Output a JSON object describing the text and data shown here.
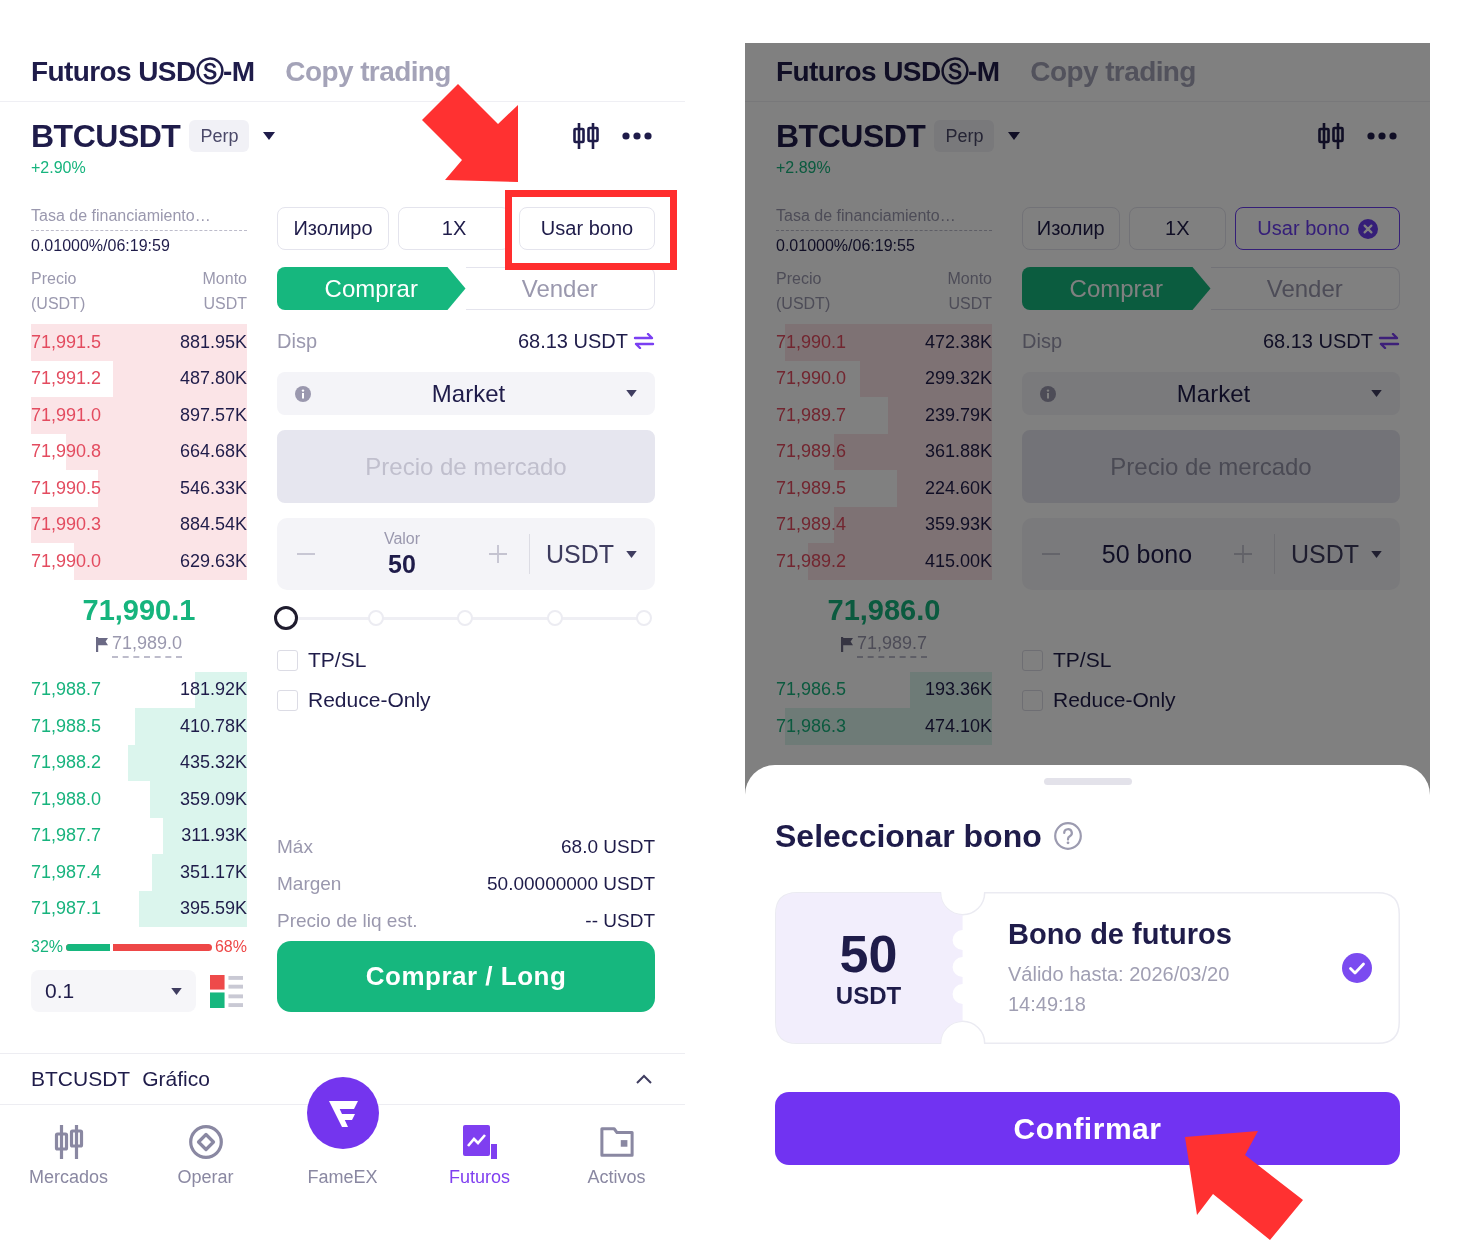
{
  "screens": [
    {
      "dimmed": false,
      "tabs": [
        {
          "label": "Futuros USDⓈ-M",
          "selected": true
        },
        {
          "label": "Copy trading",
          "selected": false
        }
      ],
      "symbol": {
        "name": "BTCUSDT",
        "badge": "Perp",
        "change": "+2.90%"
      },
      "funding": {
        "label": "Tasa de financiamiento…",
        "value": "0.01000%/06:19:59"
      },
      "book_columns": [
        "Precio (USDT)",
        "Monto USDT"
      ],
      "asks": [
        {
          "price": "71,991.5",
          "amount": "881.95K",
          "level": 1
        },
        {
          "price": "71,991.2",
          "amount": "487.80K",
          "level": 0.62
        },
        {
          "price": "71,991.0",
          "amount": "897.57K",
          "level": 1
        },
        {
          "price": "71,990.8",
          "amount": "664.68K",
          "level": 0.84
        },
        {
          "price": "71,990.5",
          "amount": "546.33K",
          "level": 0.69
        },
        {
          "price": "71,990.3",
          "amount": "884.54K",
          "level": 1
        },
        {
          "price": "71,990.0",
          "amount": "629.63K",
          "level": 0.8
        }
      ],
      "last_price": "71,990.1",
      "mark_price": "71,989.0",
      "bids": [
        {
          "price": "71,988.7",
          "amount": "181.92K",
          "level": 0.24
        },
        {
          "price": "71,988.5",
          "amount": "410.78K",
          "level": 0.52
        },
        {
          "price": "71,988.2",
          "amount": "435.32K",
          "level": 0.55
        },
        {
          "price": "71,988.0",
          "amount": "359.09K",
          "level": 0.45
        },
        {
          "price": "71,987.7",
          "amount": "311.93K",
          "level": 0.39
        },
        {
          "price": "71,987.4",
          "amount": "351.17K",
          "level": 0.44
        },
        {
          "price": "71,987.1",
          "amount": "395.59K",
          "level": 0.5
        }
      ],
      "ratio": {
        "buy": "32%",
        "sell": "68%",
        "level": 0.32
      },
      "precision": "0.1",
      "controls": [
        "Изолиро",
        "1X"
      ],
      "bonus_button": {
        "label": "Usar bono",
        "applied": false,
        "highlighted": true
      },
      "sides": [
        {
          "label": "Comprar",
          "selected": true
        },
        {
          "label": "Vender",
          "selected": false
        }
      ],
      "available": {
        "label": "Disp",
        "value": "68.13 USDT"
      },
      "order_type": "Market",
      "price_field": {
        "placeholder": "Precio de mercado",
        "disabled": true
      },
      "amount_field": {
        "label": "Valor",
        "value": "50",
        "unit": "USDT"
      },
      "slider": {
        "level": 0
      },
      "options": [
        {
          "label": "TP/SL",
          "checked": false
        },
        {
          "label": "Reduce-Only",
          "checked": false
        }
      ],
      "summary": [
        {
          "label": "Máx",
          "value": "68.0 USDT"
        },
        {
          "label": "Margen",
          "value": "50.00000000 USDT"
        },
        {
          "label": "Precio de liq est.",
          "value": "-- USDT"
        }
      ],
      "submit": "Comprar / Long",
      "chart_bar": {
        "symbol": "BTCUSDT",
        "label": "Gráfico"
      },
      "nav": [
        {
          "label": "Mercados",
          "selected": false
        },
        {
          "label": "Operar",
          "selected": false
        },
        {
          "label": "FameEX",
          "selected": false
        },
        {
          "label": "Futuros",
          "selected": true
        },
        {
          "label": "Activos",
          "selected": false
        }
      ]
    },
    {
      "dimmed": true,
      "tabs": [
        {
          "label": "Futuros USDⓈ-M",
          "selected": true
        },
        {
          "label": "Copy trading",
          "selected": false
        }
      ],
      "symbol": {
        "name": "BTCUSDT",
        "badge": "Perp",
        "change": "+2.89%"
      },
      "funding": {
        "label": "Tasa de financiamiento…",
        "value": "0.01000%/06:19:55"
      },
      "book_columns": [
        "Precio (USDT)",
        "Monto USDT"
      ],
      "asks": [
        {
          "price": "71,990.1",
          "amount": "472.38K",
          "level": 0.96
        },
        {
          "price": "71,990.0",
          "amount": "299.32K",
          "level": 0.61
        },
        {
          "price": "71,989.7",
          "amount": "239.79K",
          "level": 0.48
        },
        {
          "price": "71,989.6",
          "amount": "361.88K",
          "level": 0.73
        },
        {
          "price": "71,989.5",
          "amount": "224.60K",
          "level": 0.44
        },
        {
          "price": "71,989.4",
          "amount": "359.93K",
          "level": 0.73
        },
        {
          "price": "71,989.2",
          "amount": "415.00K",
          "level": 0.85
        }
      ],
      "last_price": "71,986.0",
      "mark_price": "71,989.7",
      "bids": [
        {
          "price": "71,986.5",
          "amount": "193.36K",
          "level": 0.38
        },
        {
          "price": "71,986.3",
          "amount": "474.10K",
          "level": 0.96
        }
      ],
      "controls": [
        "Изолир",
        "1X"
      ],
      "bonus_button": {
        "label": "Usar bono",
        "applied": true,
        "highlighted": false
      },
      "sides": [
        {
          "label": "Comprar",
          "selected": true
        },
        {
          "label": "Vender",
          "selected": false
        }
      ],
      "available": {
        "label": "Disp",
        "value": "68.13 USDT"
      },
      "order_type": "Market",
      "price_field": {
        "placeholder": "Precio de mercado",
        "disabled": true
      },
      "amount_field": {
        "value": "50 bono",
        "unit": "USDT"
      },
      "options": [
        {
          "label": "TP/SL",
          "checked": false
        },
        {
          "label": "Reduce-Only",
          "checked": false
        }
      ],
      "sheet": {
        "title": "Seleccionar bono",
        "vouchers": [
          {
            "amount": "50",
            "unit": "USDT",
            "title": "Bono de futuros",
            "validity": "Válido hasta: 2026/03/20 14:49:18",
            "selected": true
          }
        ],
        "confirm": {
          "label": "Confirmar",
          "pointed_at": true
        }
      }
    }
  ]
}
